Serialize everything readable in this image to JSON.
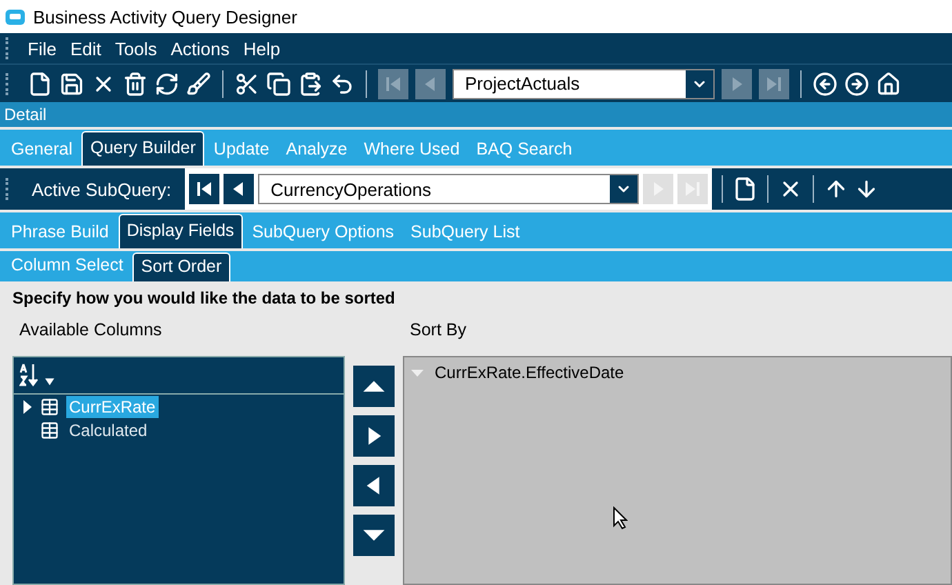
{
  "window": {
    "title": "Business Activity Query Designer"
  },
  "menu": [
    "File",
    "Edit",
    "Tools",
    "Actions",
    "Help"
  ],
  "toolbar": {
    "record": "ProjectActuals"
  },
  "section_title": "Detail",
  "tabs": [
    {
      "label": "General",
      "selected": false
    },
    {
      "label": "Query Builder",
      "selected": true
    },
    {
      "label": "Update",
      "selected": false
    },
    {
      "label": "Analyze",
      "selected": false
    },
    {
      "label": "Where Used",
      "selected": false
    },
    {
      "label": "BAQ Search",
      "selected": false
    }
  ],
  "subquery": {
    "label": "Active SubQuery:",
    "value": "CurrencyOperations"
  },
  "subtabs": [
    {
      "label": "Phrase Build",
      "selected": false
    },
    {
      "label": "Display Fields",
      "selected": true
    },
    {
      "label": "SubQuery Options",
      "selected": false
    },
    {
      "label": "SubQuery List",
      "selected": false
    }
  ],
  "sort_tabs": [
    {
      "label": "Column Select",
      "selected": false
    },
    {
      "label": "Sort Order",
      "selected": true
    }
  ],
  "instruction": "Specify how you would like the data to be sorted",
  "available": {
    "title": "Available Columns",
    "items": [
      {
        "label": "CurrExRate",
        "selected": true,
        "expandable": true
      },
      {
        "label": "Calculated",
        "selected": false,
        "expandable": false
      }
    ]
  },
  "sort_by": {
    "title": "Sort By",
    "items": [
      "CurrExRate.EffectiveDate"
    ]
  }
}
